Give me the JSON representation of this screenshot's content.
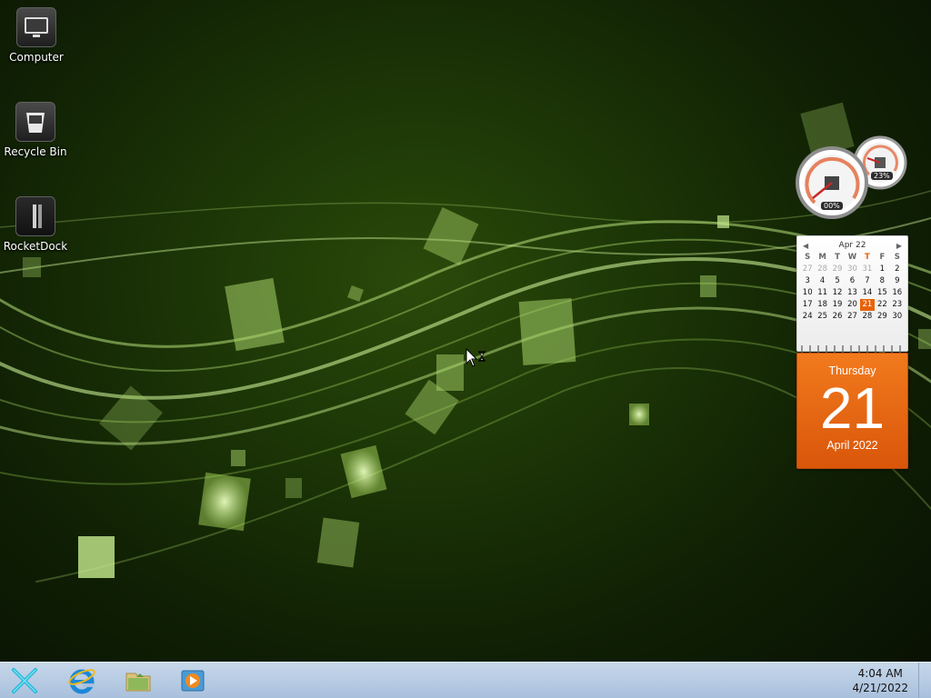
{
  "desktop": {
    "icons": [
      {
        "label": "Computer",
        "icon": "computer-icon"
      },
      {
        "label": "Recycle Bin",
        "icon": "recycle-bin-icon"
      },
      {
        "label": "RocketDock",
        "icon": "rocketdock-icon"
      }
    ]
  },
  "gauges": {
    "cpu_label": "00%",
    "memory_label": "23%"
  },
  "calendar": {
    "month_header": "Apr 22",
    "weekdays": [
      "S",
      "M",
      "T",
      "W",
      "T",
      "F",
      "S"
    ],
    "weeks": [
      [
        "27",
        "28",
        "29",
        "30",
        "31",
        "1",
        "2"
      ],
      [
        "3",
        "4",
        "5",
        "6",
        "7",
        "8",
        "9"
      ],
      [
        "10",
        "11",
        "12",
        "13",
        "14",
        "15",
        "16"
      ],
      [
        "17",
        "18",
        "19",
        "20",
        "21",
        "22",
        "23"
      ],
      [
        "24",
        "25",
        "26",
        "27",
        "28",
        "29",
        "30"
      ]
    ],
    "weekday_name": "Thursday",
    "day": "21",
    "month_year": "April 2022"
  },
  "taskbar": {
    "start_icon": "start-x-icon",
    "pinned": [
      {
        "icon": "internet-explorer-icon"
      },
      {
        "icon": "file-explorer-icon"
      },
      {
        "icon": "media-player-icon"
      }
    ],
    "clock_time": "4:04 AM",
    "clock_date": "4/21/2022"
  },
  "colors": {
    "accent_orange": "#e8630a",
    "taskbar": "#b8cce3",
    "wallpaper_green": "#8bc34a"
  }
}
